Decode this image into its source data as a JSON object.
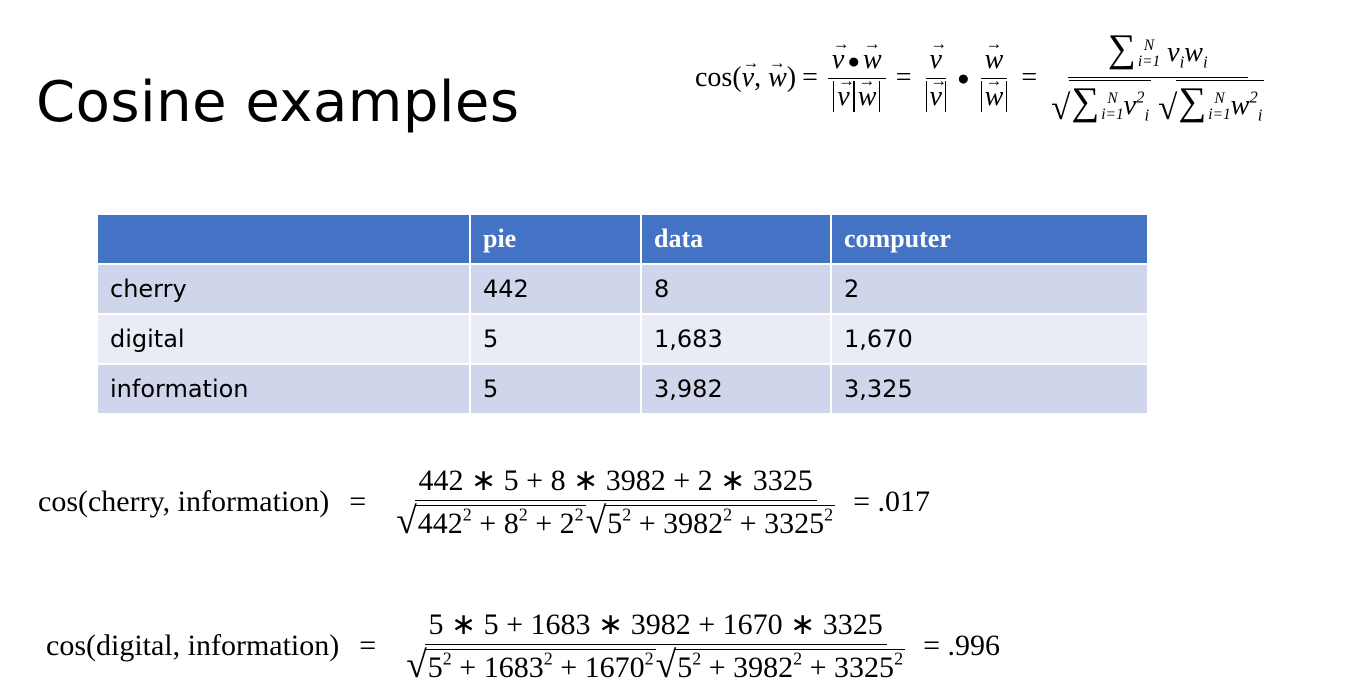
{
  "title": "Cosine examples",
  "formula": {
    "lhs": "cos(",
    "v": "v",
    "comma": ", ",
    "w": "w",
    "close": ")",
    "eq": "=",
    "sum_lower": "i=1",
    "sum_upper": "N",
    "term_v": "v",
    "term_w": "w",
    "idx": "i",
    "sq": "2"
  },
  "table": {
    "headers": [
      "",
      "pie",
      "data",
      "computer"
    ],
    "rows": [
      [
        "cherry",
        "442",
        "8",
        "2"
      ],
      [
        "digital",
        "5",
        "1,683",
        "1,670"
      ],
      [
        "information",
        "5",
        "3,982",
        "3,325"
      ]
    ]
  },
  "example1": {
    "lhs": "cos(cherry, information)",
    "eq": "=",
    "numerator": "442 ∗ 5 + 8 ∗ 3982 + 2 ∗ 3325",
    "den_left": [
      "442",
      "2",
      " + 8",
      "2",
      " + 2",
      "2"
    ],
    "den_right": [
      "5",
      "2",
      " + 3982",
      "2",
      " + 3325",
      "2"
    ],
    "result": "= .017"
  },
  "example2": {
    "lhs": "cos(digital, information)",
    "eq": "=",
    "numerator": "5 ∗ 5 + 1683 ∗ 3982 + 1670 ∗ 3325",
    "den_left": [
      "5",
      "2",
      " + 1683",
      "2",
      " + 1670",
      "2"
    ],
    "den_right": [
      "5",
      "2",
      " + 3982",
      "2",
      " + 3325",
      "2"
    ],
    "result": "= .996"
  }
}
